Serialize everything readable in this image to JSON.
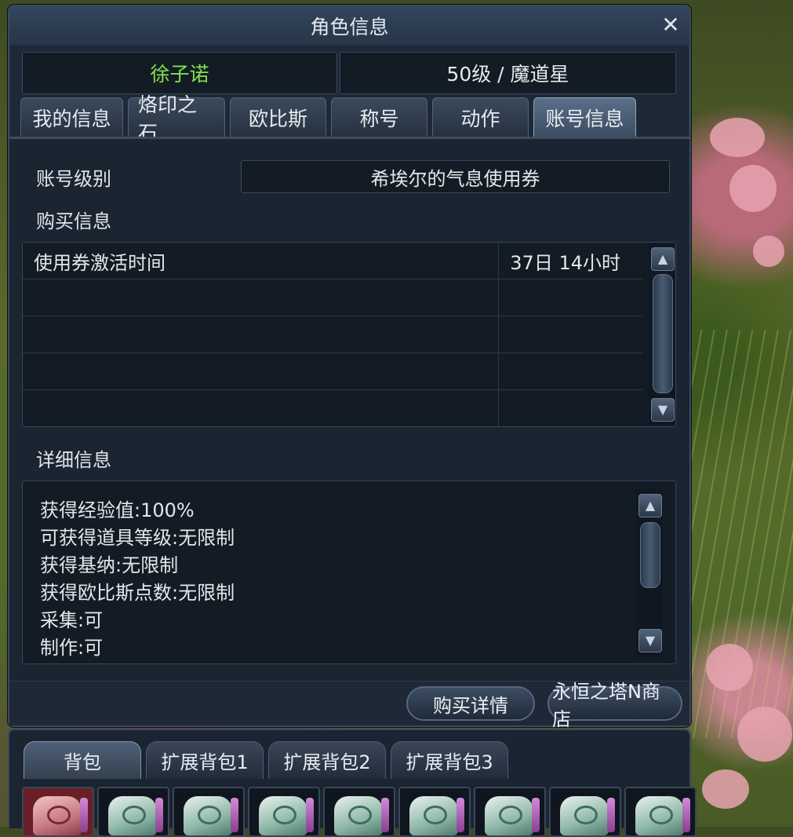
{
  "window": {
    "title": "角色信息",
    "close_glyph": "✕",
    "character_name": "徐子诺",
    "character_level_class": "50级 / 魔道星"
  },
  "tabs": [
    {
      "label": "我的信息",
      "active": false
    },
    {
      "label": "烙印之石",
      "active": false
    },
    {
      "label": "欧比斯",
      "active": false
    },
    {
      "label": "称号",
      "active": false
    },
    {
      "label": "动作",
      "active": false
    },
    {
      "label": "账号信息",
      "active": true
    }
  ],
  "account": {
    "type_label": "账号级别",
    "type_value": "希埃尔的气息使用券",
    "purchase_label": "购买信息",
    "purchase_rows": [
      {
        "name": "使用券激活时间",
        "value": "37日 14小时"
      },
      {
        "name": "",
        "value": ""
      },
      {
        "name": "",
        "value": ""
      },
      {
        "name": "",
        "value": ""
      },
      {
        "name": "",
        "value": ""
      }
    ],
    "detail_label": "详细信息",
    "details": [
      "获得经验值:100%",
      "可获得道具等级:无限制",
      "获得基纳:无限制",
      "获得欧比斯点数:无限制",
      "采集:可",
      "制作:可"
    ]
  },
  "scroll": {
    "up_glyph": "▲",
    "down_glyph": "▼"
  },
  "footer": {
    "purchase_details_label": "购买详情",
    "shop_label": "永恒之塔N商店"
  },
  "inventory": {
    "tabs": [
      {
        "label": "背包",
        "active": true
      },
      {
        "label": "扩展背包1",
        "active": false
      },
      {
        "label": "扩展背包2",
        "active": false
      },
      {
        "label": "扩展背包3",
        "active": false
      }
    ],
    "slot_icons": [
      "red-rune-stone-icon",
      "rune-stone-icon",
      "rune-stone-icon",
      "rune-stone-icon",
      "rune-stone-icon",
      "rune-stone-icon",
      "rune-stone-icon",
      "rune-stone-icon",
      "rune-stone-icon"
    ]
  }
}
